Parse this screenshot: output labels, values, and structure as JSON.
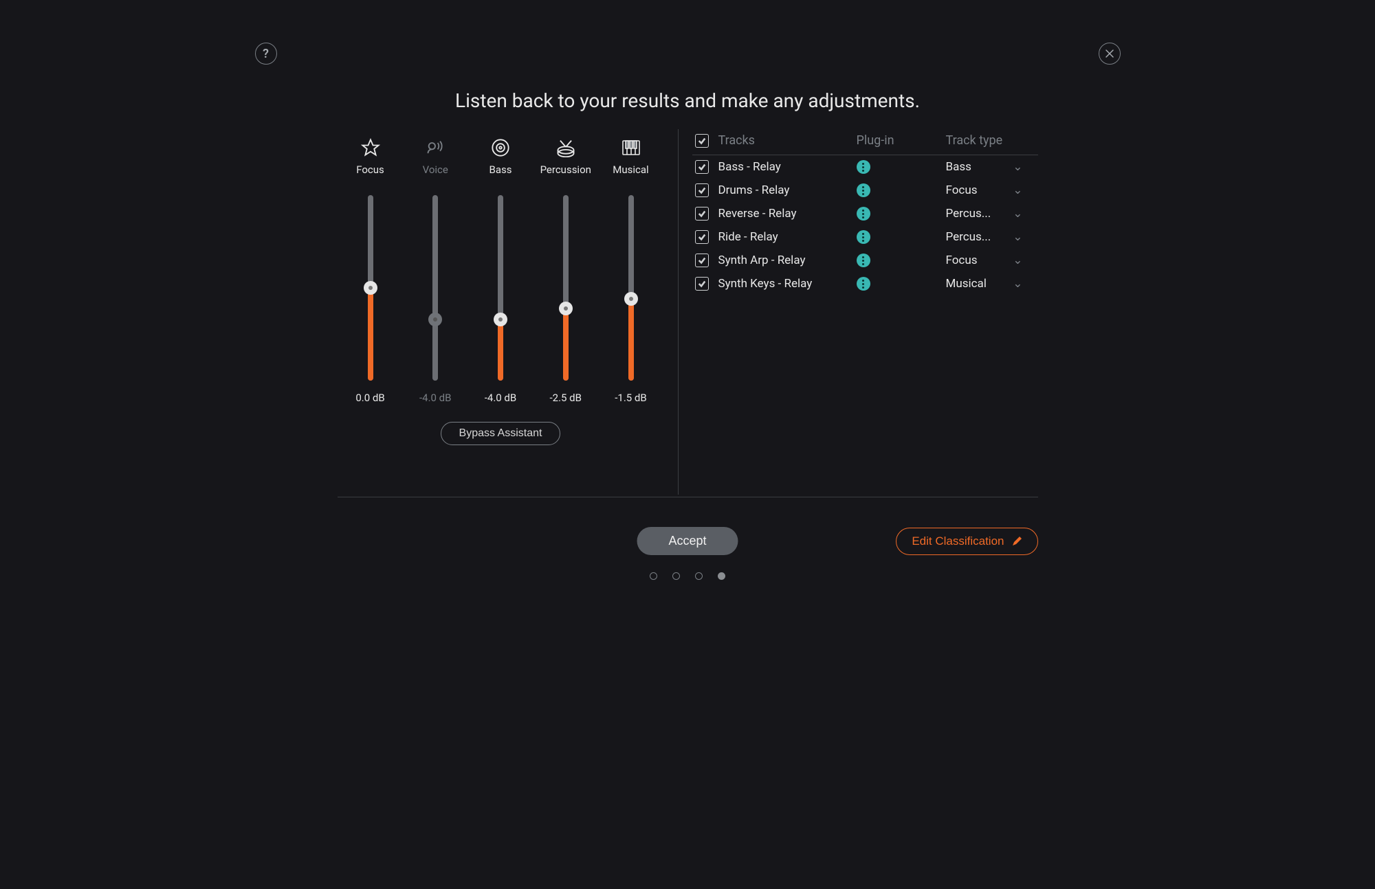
{
  "title": "Listen back to your results and make any adjustments.",
  "help_icon": "?",
  "categories": [
    {
      "key": "focus",
      "label": "Focus",
      "db_label": "0.0 dB",
      "percent": 50,
      "icon": "star",
      "active": true
    },
    {
      "key": "voice",
      "label": "Voice",
      "db_label": "-4.0 dB",
      "percent": 33,
      "icon": "voice",
      "active": false
    },
    {
      "key": "bass",
      "label": "Bass",
      "db_label": "-4.0 dB",
      "percent": 33,
      "icon": "speaker",
      "active": true
    },
    {
      "key": "percussion",
      "label": "Percussion",
      "db_label": "-2.5 dB",
      "percent": 39,
      "icon": "drum",
      "active": true
    },
    {
      "key": "musical",
      "label": "Musical",
      "db_label": "-1.5 dB",
      "percent": 44,
      "icon": "piano",
      "active": true
    }
  ],
  "bypass_label": "Bypass Assistant",
  "table": {
    "head": {
      "tracks": "Tracks",
      "plugin": "Plug-in",
      "type": "Track type"
    },
    "rows": [
      {
        "name": "Bass - Relay",
        "type": "Bass"
      },
      {
        "name": "Drums - Relay",
        "type": "Focus"
      },
      {
        "name": "Reverse - Relay",
        "type": "Percus..."
      },
      {
        "name": "Ride - Relay",
        "type": "Percus..."
      },
      {
        "name": "Synth Arp - Relay",
        "type": "Focus"
      },
      {
        "name": "Synth Keys - Relay",
        "type": "Musical"
      }
    ]
  },
  "accept_label": "Accept",
  "edit_label": "Edit Classification",
  "pager": {
    "count": 4,
    "active": 3
  }
}
